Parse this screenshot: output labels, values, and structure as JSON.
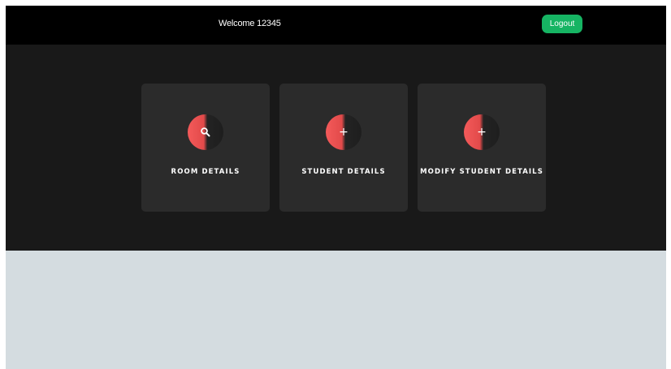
{
  "header": {
    "welcome_text": "Welcome 12345",
    "logout_label": "Logout"
  },
  "cards": [
    {
      "label": "ROOM DETAILS",
      "icon": "search-icon"
    },
    {
      "label": "STUDENT DETAILS",
      "icon": "plus-icon",
      "glyph": "+"
    },
    {
      "label": "MODIFY STUDENT DETAILS",
      "icon": "plus-icon",
      "glyph": "+"
    }
  ],
  "colors": {
    "header_bg": "#000000",
    "main_bg": "#191919",
    "card_bg": "#2b2b2b",
    "accent": "#f45a5a",
    "logout_button": "#16b463",
    "page_bg": "#d4dce0"
  }
}
